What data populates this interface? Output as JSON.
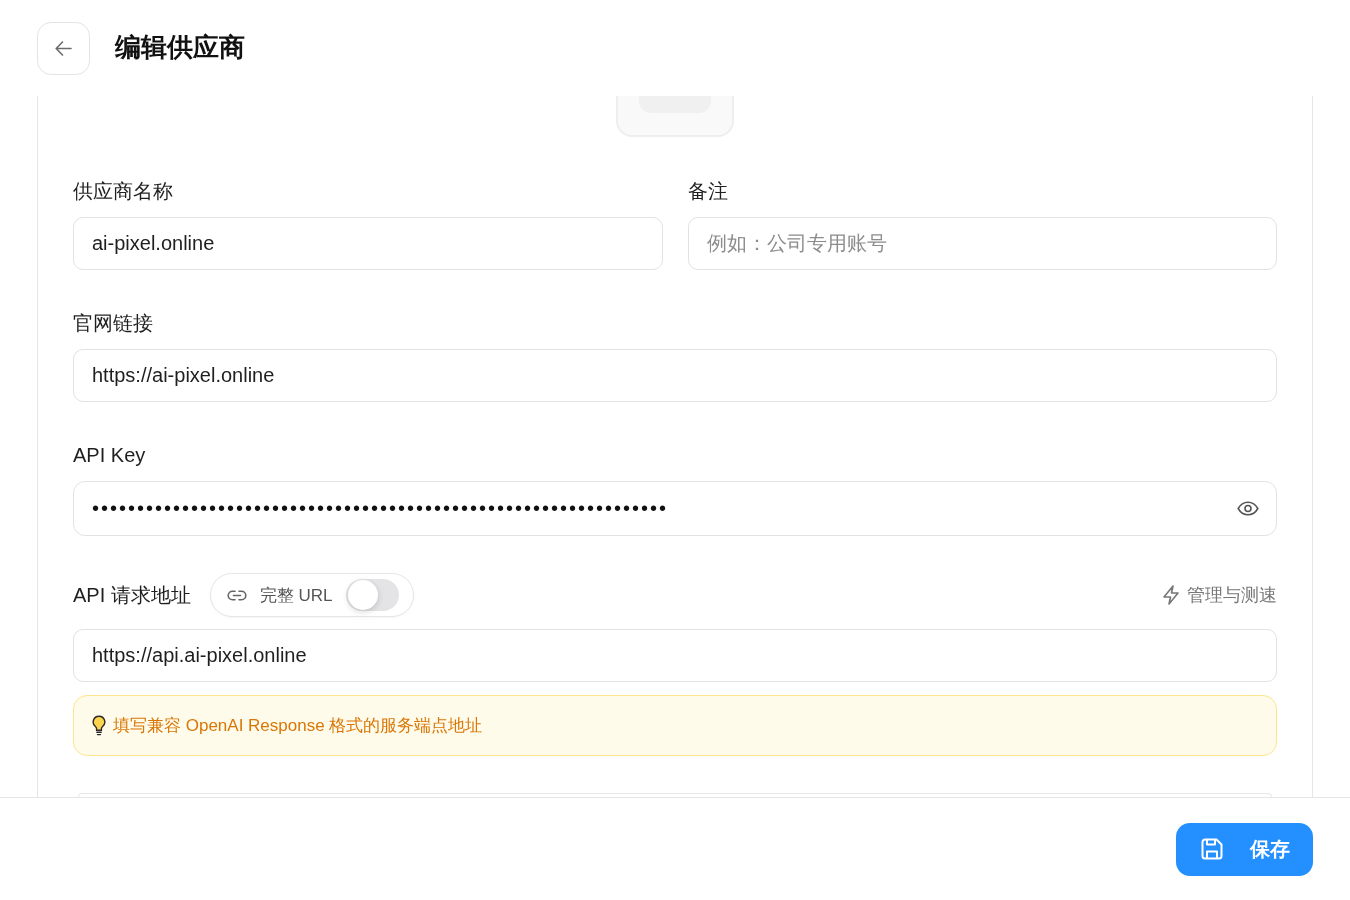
{
  "header": {
    "title": "编辑供应商"
  },
  "form": {
    "name_field": {
      "label": "供应商名称",
      "value": "ai-pixel.online"
    },
    "note_field": {
      "label": "备注",
      "placeholder": "例如：公司专用账号"
    },
    "website_field": {
      "label": "官网链接",
      "value": "https://ai-pixel.online"
    },
    "api_key_field": {
      "label": "API Key",
      "value": "••••••••••••••••••••••••••••••••••••••••••••••••••••••••••••••••"
    },
    "endpoint_field": {
      "label": "API 请求地址",
      "full_url_toggle": {
        "label": "完整 URL",
        "on": false
      },
      "test_link": "管理与测速",
      "value": "https://api.ai-pixel.online",
      "hint": "填写兼容 OpenAI Response 格式的服务端点地址"
    }
  },
  "footer": {
    "save_button": "保存"
  }
}
